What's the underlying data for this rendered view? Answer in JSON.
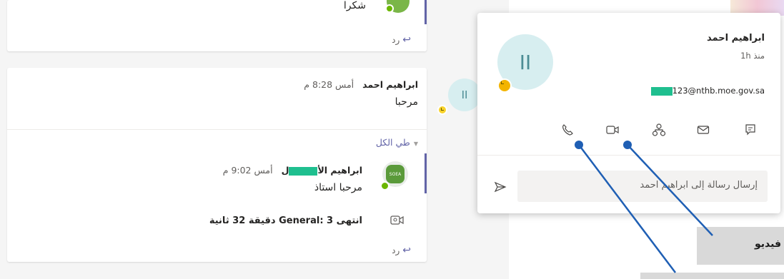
{
  "top_message": {
    "text": "شكرا",
    "reply": "رد"
  },
  "thread": {
    "first": {
      "avatar_text": "II",
      "author": "ابراهيم احمد",
      "time": "أمس 8:28 م",
      "text": "مرحبا"
    },
    "collapse_label": "طي الكل",
    "second": {
      "avatar_label": "SOEA",
      "author_prefix": "ابراهيم الأ",
      "author_suffix": "ل",
      "time": "أمس 9:02 م",
      "text": "مرحبا استاذ"
    },
    "meeting_ended": "انتهى General: 3 دقيقة 32 ثانية",
    "reply": "رد"
  },
  "popup": {
    "avatar_text": "II",
    "name": "ابراهيم احمد",
    "status": "منذ 1h",
    "email_visible": "123@nthb.moe.gov.sa",
    "actions": [
      "call-icon",
      "video-icon",
      "org-chart-icon",
      "mail-icon",
      "chat-icon"
    ],
    "message_placeholder": "إرسال رسالة إلى ابراهيم احمد"
  },
  "callouts": {
    "video_label": "فيديو"
  },
  "colors": {
    "accent": "#6264a7",
    "callout_line": "#1f5fb4",
    "redaction": "#1fbf8f",
    "status_away": "#f8d22a",
    "status_available": "#6bb700"
  }
}
